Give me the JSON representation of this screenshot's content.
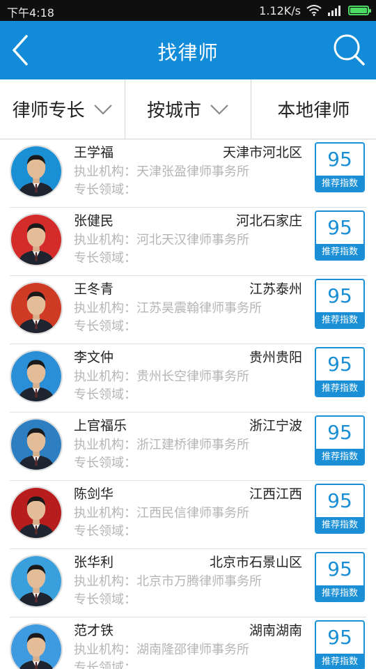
{
  "status_bar": {
    "time": "下午4:18",
    "speed": "1.12K/s",
    "icons": [
      "wifi-icon",
      "signal-icon",
      "battery-icon"
    ]
  },
  "header": {
    "title": "找律师",
    "back_icon": "back-arrow-icon",
    "search_icon": "search-icon",
    "color": "#128bd8"
  },
  "filters": [
    {
      "label": "律师专长",
      "has_dropdown": true
    },
    {
      "label": "按城市",
      "has_dropdown": true
    },
    {
      "label": "本地律师",
      "has_dropdown": false
    }
  ],
  "labels": {
    "org_prefix": "执业机构：",
    "specialty_prefix": "专长领域：",
    "score_label": "推荐指数"
  },
  "lawyers": [
    {
      "name": "王学福",
      "location": "天津市河北区",
      "org": "天津张盈律师事务所",
      "specialty": "",
      "score": "95",
      "bg": "#1b8fd3"
    },
    {
      "name": "张健民",
      "location": "河北石家庄",
      "org": "河北天汉律师事务所",
      "specialty": "",
      "score": "95",
      "bg": "#d42b2b"
    },
    {
      "name": "王冬青",
      "location": "江苏泰州",
      "org": "江苏昊震翰律师事务所",
      "specialty": "",
      "score": "95",
      "bg": "#cf3a24"
    },
    {
      "name": "李文仲",
      "location": "贵州贵阳",
      "org": "贵州长空律师事务所",
      "specialty": "",
      "score": "95",
      "bg": "#2a8fd6"
    },
    {
      "name": "上官福乐",
      "location": "浙江宁波",
      "org": "浙江建桥律师事务所",
      "specialty": "",
      "score": "95",
      "bg": "#2d7fc2"
    },
    {
      "name": "陈剑华",
      "location": "江西江西",
      "org": "江西民信律师事务所",
      "specialty": "",
      "score": "95",
      "bg": "#b71d1d"
    },
    {
      "name": "张华利",
      "location": "北京市石景山区",
      "org": "北京市万腾律师事务所",
      "specialty": "",
      "score": "95",
      "bg": "#3aa0dd"
    },
    {
      "name": "范才铁",
      "location": "湖南湖南",
      "org": "湖南隆邵律师事务所",
      "specialty": "",
      "score": "95",
      "bg": "#3f9be0"
    }
  ]
}
